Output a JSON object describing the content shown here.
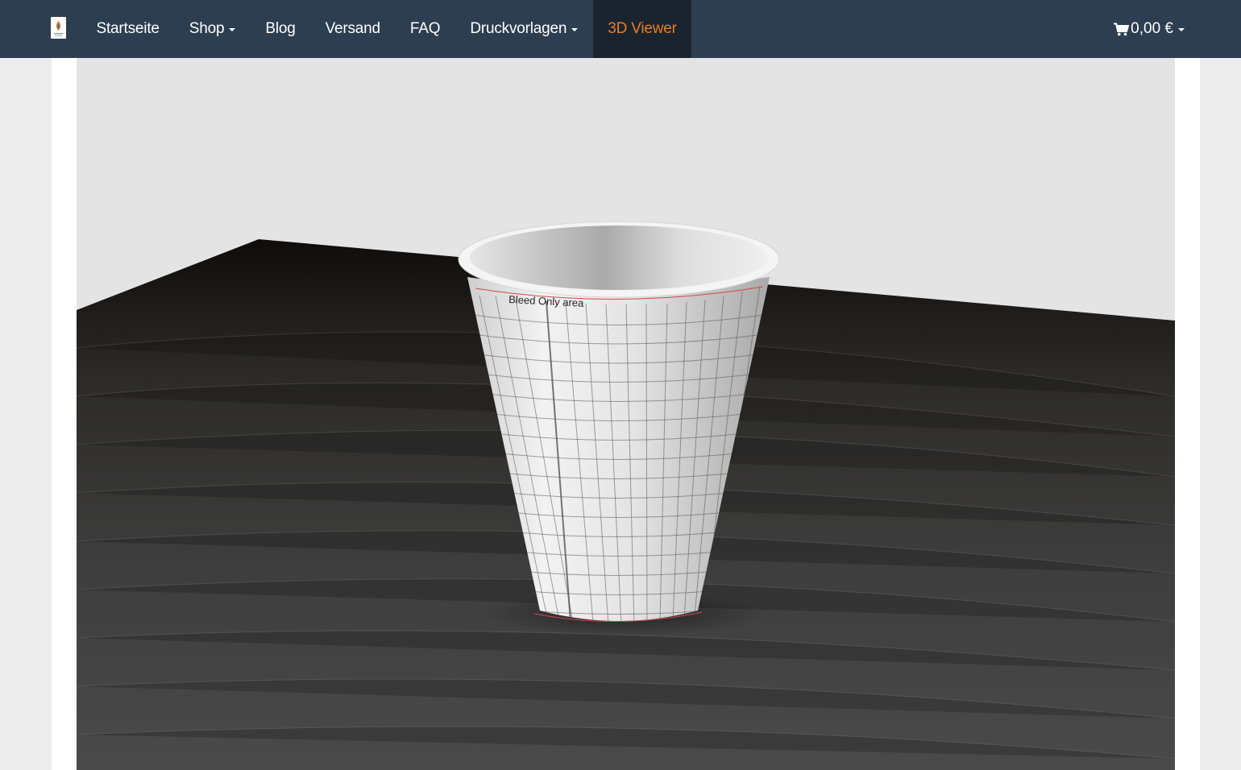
{
  "navbar": {
    "brand_icon": "logo-icon",
    "items": [
      {
        "label": "Startseite",
        "dropdown": false,
        "active": false
      },
      {
        "label": "Shop",
        "dropdown": true,
        "active": false
      },
      {
        "label": "Blog",
        "dropdown": false,
        "active": false
      },
      {
        "label": "Versand",
        "dropdown": false,
        "active": false
      },
      {
        "label": "FAQ",
        "dropdown": false,
        "active": false
      },
      {
        "label": "Druckvorlagen",
        "dropdown": true,
        "active": false
      },
      {
        "label": "3D Viewer",
        "dropdown": false,
        "active": true
      }
    ],
    "cart": {
      "icon": "shopping-cart-icon",
      "amount": "0,00 €",
      "dropdown": true
    }
  },
  "viewer": {
    "cup_label": "Bleed Only area"
  },
  "colors": {
    "navbar_bg": "#2c3e50",
    "active_bg": "#1a242f",
    "accent": "#e67e22",
    "page_bg": "#ececec",
    "viewer_wall": "#e4e4e4",
    "table": "#3a3a3a"
  }
}
